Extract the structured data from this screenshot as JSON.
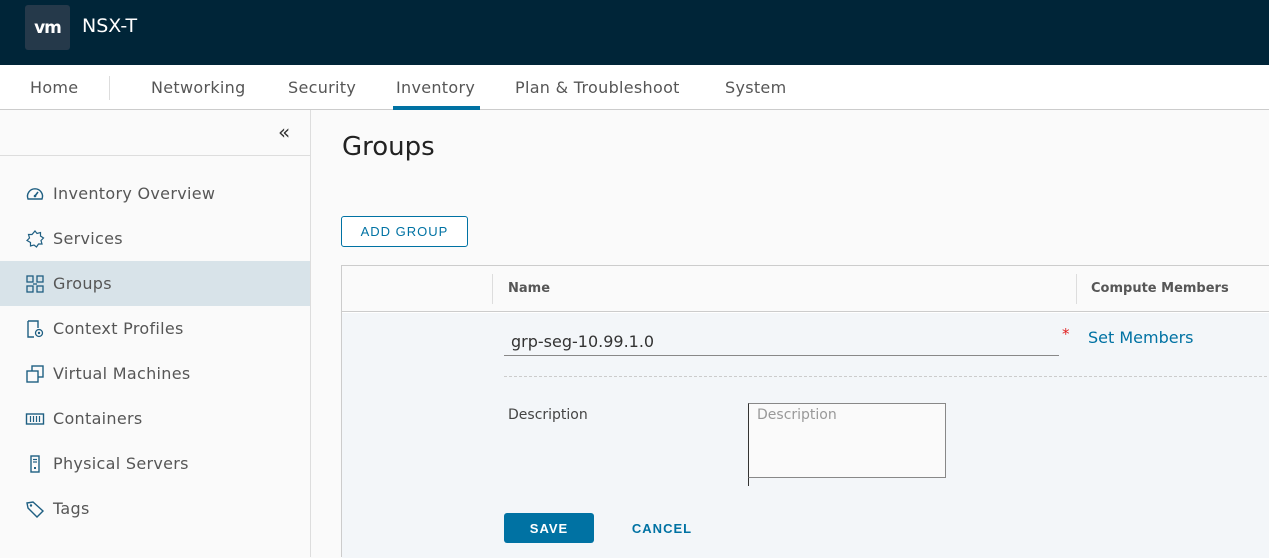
{
  "header": {
    "logo_text": "vm",
    "app_title": "NSX-T"
  },
  "nav": {
    "items": [
      {
        "label": "Home"
      },
      {
        "label": "Networking"
      },
      {
        "label": "Security"
      },
      {
        "label": "Inventory",
        "active": true
      },
      {
        "label": "Plan & Troubleshoot"
      },
      {
        "label": "System"
      }
    ]
  },
  "sidebar": {
    "collapse_icon": "«",
    "items": [
      {
        "label": "Inventory Overview",
        "icon": "dashboard-icon"
      },
      {
        "label": "Services",
        "icon": "gear-icon"
      },
      {
        "label": "Groups",
        "icon": "groups-icon",
        "active": true
      },
      {
        "label": "Context Profiles",
        "icon": "context-profile-icon"
      },
      {
        "label": "Virtual Machines",
        "icon": "vm-icon"
      },
      {
        "label": "Containers",
        "icon": "container-icon"
      },
      {
        "label": "Physical Servers",
        "icon": "server-icon"
      },
      {
        "label": "Tags",
        "icon": "tag-icon"
      }
    ]
  },
  "main": {
    "title": "Groups",
    "add_button": "ADD GROUP",
    "grid": {
      "columns": [
        "Name",
        "Compute Members"
      ],
      "edit_row": {
        "name_value": "grp-seg-10.99.1.0",
        "required_marker": "*",
        "set_members_link": "Set Members",
        "description_label": "Description",
        "description_placeholder": "Description",
        "description_value": "",
        "save_label": "SAVE",
        "cancel_label": "CANCEL"
      }
    }
  },
  "colors": {
    "header_bg": "#002538",
    "accent": "#0072a3",
    "active_sidebar": "#d8e3e9",
    "required": "#e02020"
  }
}
